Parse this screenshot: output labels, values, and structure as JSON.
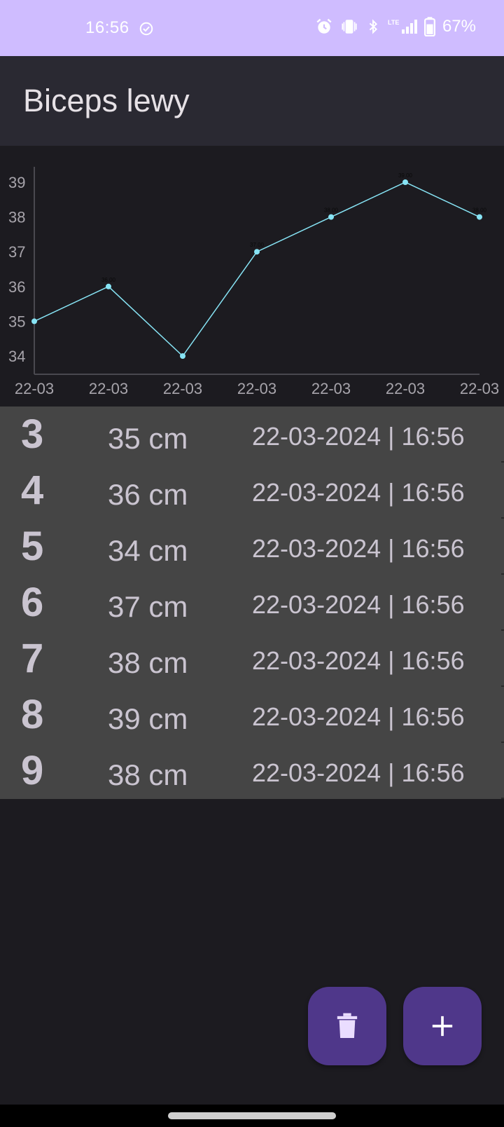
{
  "status_bar": {
    "time": "16:56",
    "battery": "67%",
    "icons": [
      "check-circle-icon",
      "alarm-icon",
      "vibrate-icon",
      "bluetooth-icon",
      "lte-signal-icon",
      "battery-icon"
    ]
  },
  "app_bar": {
    "title": "Biceps lewy"
  },
  "chart_data": {
    "type": "line",
    "categories": [
      "22-03",
      "22-03",
      "22-03",
      "22-03",
      "22-03",
      "22-03",
      "22-03"
    ],
    "series": [
      {
        "values": [
          35,
          36,
          34,
          37,
          38,
          39,
          38
        ]
      }
    ],
    "point_labels": [
      "",
      "36.00",
      "",
      "37.00",
      "38.00",
      "39.00",
      "38.00"
    ],
    "y_ticks": [
      "34",
      "35",
      "36",
      "37",
      "38",
      "39"
    ],
    "ylim": [
      34,
      39
    ],
    "line_color": "#87e4f5",
    "grid": false
  },
  "entries": [
    {
      "index": "3",
      "value": "35 cm",
      "date": "22-03-2024 | 16:56"
    },
    {
      "index": "4",
      "value": "36 cm",
      "date": "22-03-2024 | 16:56"
    },
    {
      "index": "5",
      "value": "34 cm",
      "date": "22-03-2024 | 16:56"
    },
    {
      "index": "6",
      "value": "37 cm",
      "date": "22-03-2024 | 16:56"
    },
    {
      "index": "7",
      "value": "38 cm",
      "date": "22-03-2024 | 16:56"
    },
    {
      "index": "8",
      "value": "39 cm",
      "date": "22-03-2024 | 16:56"
    },
    {
      "index": "9",
      "value": "38 cm",
      "date": "22-03-2024 | 16:56"
    }
  ],
  "actions": {
    "delete_icon": "trash-icon",
    "add_icon": "plus-icon"
  },
  "colors": {
    "status_bar": "#cfbcff",
    "app_bar": "#2a2932",
    "background": "#1c1b20",
    "list_background": "#454545",
    "fab": "#4f378a"
  }
}
